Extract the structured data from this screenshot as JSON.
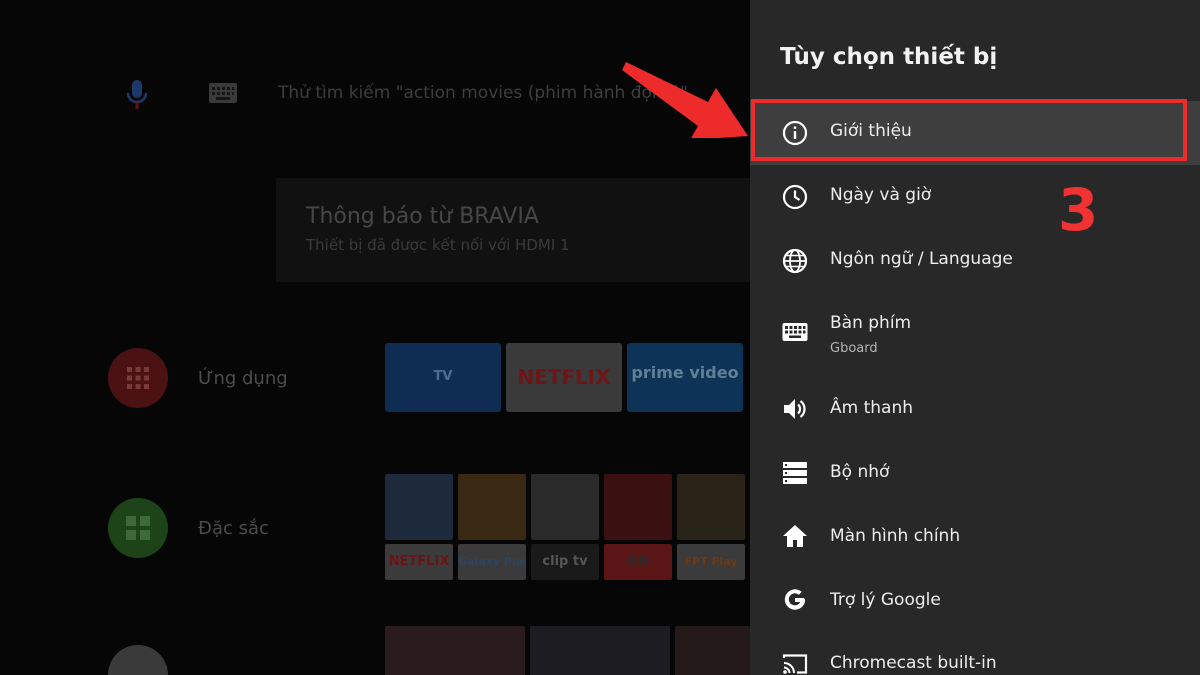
{
  "background": {
    "search_hint": "Thử tìm kiếm \"action movies (phim hành động)\"",
    "notification": {
      "title": "Thông báo từ BRAVIA",
      "subtitle": "Thiết bị đã được kết nối với HDMI 1"
    },
    "rows": [
      {
        "label": "Ứng dụng",
        "icon": "apps-grid-icon",
        "color": "#5a1414"
      },
      {
        "label": "Đặc sắc",
        "icon": "featured-grid-icon",
        "color": "#1f4a1a"
      }
    ],
    "app_tiles": [
      {
        "label": "TV",
        "bg": "#11305a",
        "color": "#4d6c92"
      },
      {
        "label": "NETFLIX",
        "bg": "#3a3a3a",
        "color": "#701515"
      },
      {
        "label": "prime video",
        "bg": "#0e3558",
        "color": "#5f8095"
      }
    ],
    "featured_tags": [
      "NETFLIX",
      "Galaxy Play",
      "clip tv",
      "ON",
      "FPT Play"
    ]
  },
  "panel": {
    "title": "Tùy chọn thiết bị",
    "items": [
      {
        "label": "Giới thiệu",
        "icon": "info-icon",
        "active": true
      },
      {
        "label": "Ngày và giờ",
        "icon": "clock-icon"
      },
      {
        "label": "Ngôn ngữ / Language",
        "icon": "globe-icon"
      },
      {
        "label": "Bàn phím",
        "sublabel": "Gboard",
        "icon": "keyboard-icon"
      },
      {
        "label": "Âm thanh",
        "icon": "volume-icon"
      },
      {
        "label": "Bộ nhớ",
        "icon": "storage-icon"
      },
      {
        "label": "Màn hình chính",
        "icon": "home-icon"
      },
      {
        "label": "Trợ lý Google",
        "icon": "google-icon"
      },
      {
        "label": "Chromecast built-in",
        "icon": "cast-icon"
      }
    ]
  },
  "annotation": {
    "step_number": "3",
    "color": "#ee2b2b"
  }
}
